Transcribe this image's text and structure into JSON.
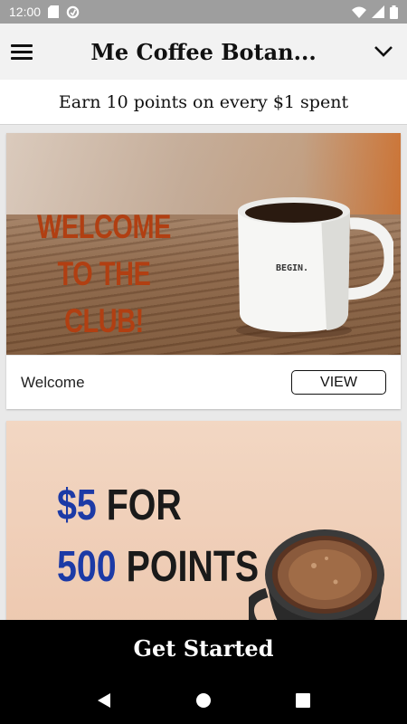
{
  "status_bar": {
    "time": "12:00"
  },
  "header": {
    "title": "Me Coffee Botan..."
  },
  "earn_banner": {
    "text": "Earn 10 points on every $1 spent"
  },
  "cards": [
    {
      "image_text": "WELCOME\nTO THE CLUB!",
      "mug_text": "BEGIN.",
      "label": "Welcome",
      "button_label": "VIEW"
    },
    {
      "promo_line1_accent": "$5",
      "promo_line1_rest": " FOR",
      "promo_line2_accent": "500",
      "promo_line2_rest": " POINTS"
    }
  ],
  "cta": {
    "label": "Get Started"
  },
  "colors": {
    "status_bar": "#9e9e9e",
    "header_bg": "#f2f2f2",
    "welcome_text": "#b13f12",
    "promo_blue": "#1c3aa6",
    "cta_bg": "#000000"
  },
  "icons": {
    "status": [
      "sd-card-icon",
      "data-saver-icon",
      "wifi-icon",
      "cellular-signal-icon",
      "battery-icon"
    ],
    "header": [
      "hamburger-menu-icon",
      "chevron-down-icon"
    ],
    "nav": [
      "back-triangle-icon",
      "home-circle-icon",
      "recents-square-icon"
    ]
  }
}
